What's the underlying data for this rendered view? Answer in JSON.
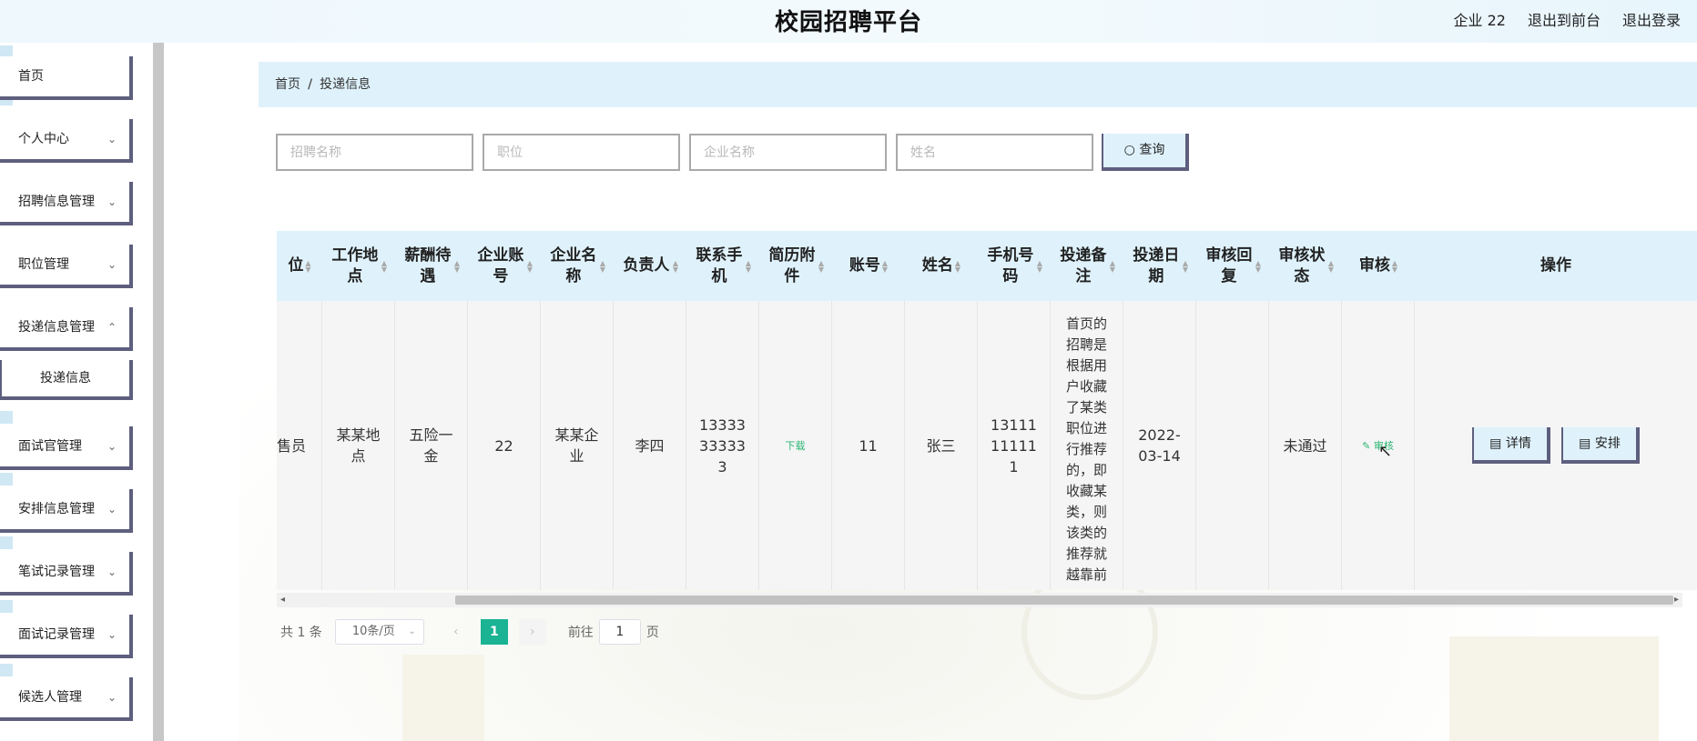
{
  "header": {
    "title": "校园招聘平台",
    "user_label": "企业 22",
    "exit_front_label": "退出到前台",
    "logout_label": "退出登录"
  },
  "sidebar": {
    "items": [
      {
        "label": "首页",
        "expandable": false
      },
      {
        "label": "个人中心",
        "expandable": true
      },
      {
        "label": "招聘信息管理",
        "expandable": true
      },
      {
        "label": "职位管理",
        "expandable": true
      },
      {
        "label": "投递信息管理",
        "expandable": true
      },
      {
        "label": "投递信息",
        "expandable": false,
        "sub": true
      },
      {
        "label": "面试官管理",
        "expandable": true
      },
      {
        "label": "安排信息管理",
        "expandable": true
      },
      {
        "label": "笔试记录管理",
        "expandable": true
      },
      {
        "label": "面试记录管理",
        "expandable": true
      },
      {
        "label": "候选人管理",
        "expandable": true
      }
    ]
  },
  "breadcrumb": {
    "home": "首页",
    "separator": "/",
    "current": "投递信息"
  },
  "search": {
    "recruit_name_placeholder": "招聘名称",
    "position_placeholder": "职位",
    "company_placeholder": "企业名称",
    "name_placeholder": "姓名",
    "query_label": "查询",
    "query_icon": "search-icon"
  },
  "table": {
    "headers": [
      "位",
      "工作地点",
      "薪酬待遇",
      "企业账号",
      "企业名称",
      "负责人",
      "联系手机",
      "简历附件",
      "账号",
      "姓名",
      "手机号码",
      "投递备注",
      "投递日期",
      "审核回复",
      "审核状态",
      "审核",
      "操作"
    ],
    "row": {
      "position": "售员",
      "location": "某某地点",
      "salary": "五险一金",
      "company_account": "22",
      "company_name": "某某企业",
      "manager": "李四",
      "contact_phone": "13333333333",
      "resume": "下载",
      "account": "11",
      "name": "张三",
      "phone": "13111111111",
      "note": "首页的招聘是根据用户收藏了某类职位进行推荐的，即收藏某类，则该类的推荐就越靠前",
      "date": "2022-03-14",
      "reply": "",
      "status": "未通过",
      "review": "审核",
      "detail": "详情",
      "arrange": "安排"
    }
  },
  "pagination": {
    "total": "共 1 条",
    "page_size": "10条/页",
    "current_page": "1",
    "goto_prefix": "前往",
    "goto_value": "1",
    "goto_suffix": "页"
  },
  "colors": {
    "header_bg": "#eef8fd",
    "light_blue": "#dff2fc",
    "border_dark": "#5e5f7e",
    "page_active": "#1ab394",
    "download_green": "#2bb673"
  }
}
